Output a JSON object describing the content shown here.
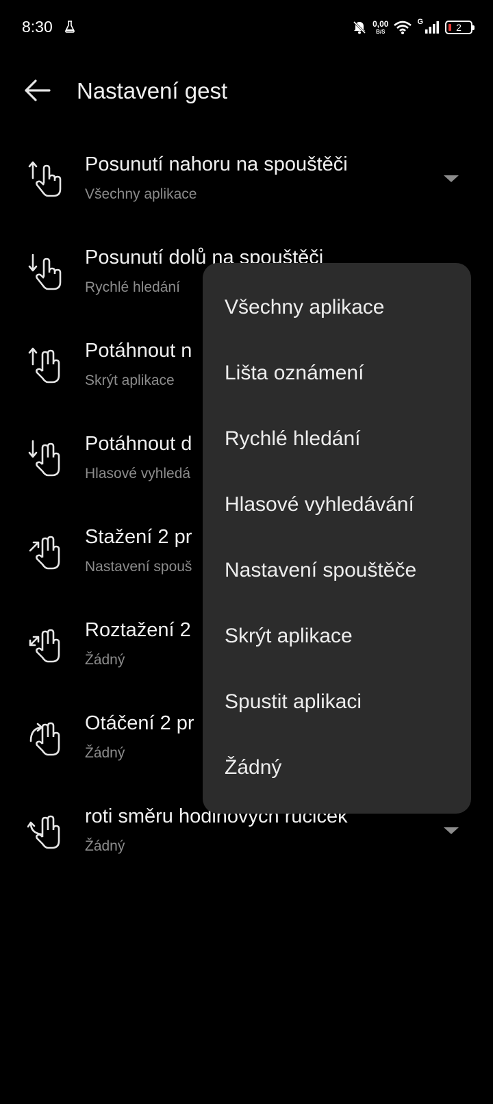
{
  "status_bar": {
    "time": "8:30",
    "net_speed_value": "0,00",
    "net_speed_unit": "B/S",
    "network_type": "G",
    "battery_level": "2"
  },
  "header": {
    "title": "Nastavení gest"
  },
  "settings": [
    {
      "label": "Posunutí nahoru na spouštěči",
      "value": "Všechny aplikace",
      "icon": "swipe-up-hand-icon"
    },
    {
      "label": "Posunutí dolů na spouštěči",
      "value": "Rychlé hledání",
      "icon": "swipe-down-hand-icon"
    },
    {
      "label": "Potáhnout n",
      "value": "Skrýt aplikace",
      "icon": "two-finger-up-icon"
    },
    {
      "label": "Potáhnout d",
      "value": "Hlasové vyhledá",
      "icon": "two-finger-down-icon"
    },
    {
      "label": "Stažení 2 pr",
      "value": "Nastavení spouš",
      "icon": "pinch-in-icon"
    },
    {
      "label": "Roztažení 2",
      "value": "Žádný",
      "icon": "pinch-out-icon"
    },
    {
      "label": "Otáčení 2 pr",
      "value": "Žádný",
      "icon": "rotate-clockwise-icon"
    },
    {
      "label": "roti směru hodinových ručiček",
      "value": "Žádný",
      "icon": "rotate-counterclockwise-icon"
    }
  ],
  "dropdown": {
    "options": [
      "Všechny aplikace",
      "Lišta oznámení",
      "Rychlé hledání",
      "Hlasové vyhledávání",
      "Nastavení spouštěče",
      "Skrýt aplikace",
      "Spustit aplikaci",
      "Žádný"
    ]
  },
  "colors": {
    "background": "#000000",
    "menu_bg": "#2c2c2c",
    "secondary_text": "#8c8c8c",
    "battery_low": "#e53935"
  }
}
